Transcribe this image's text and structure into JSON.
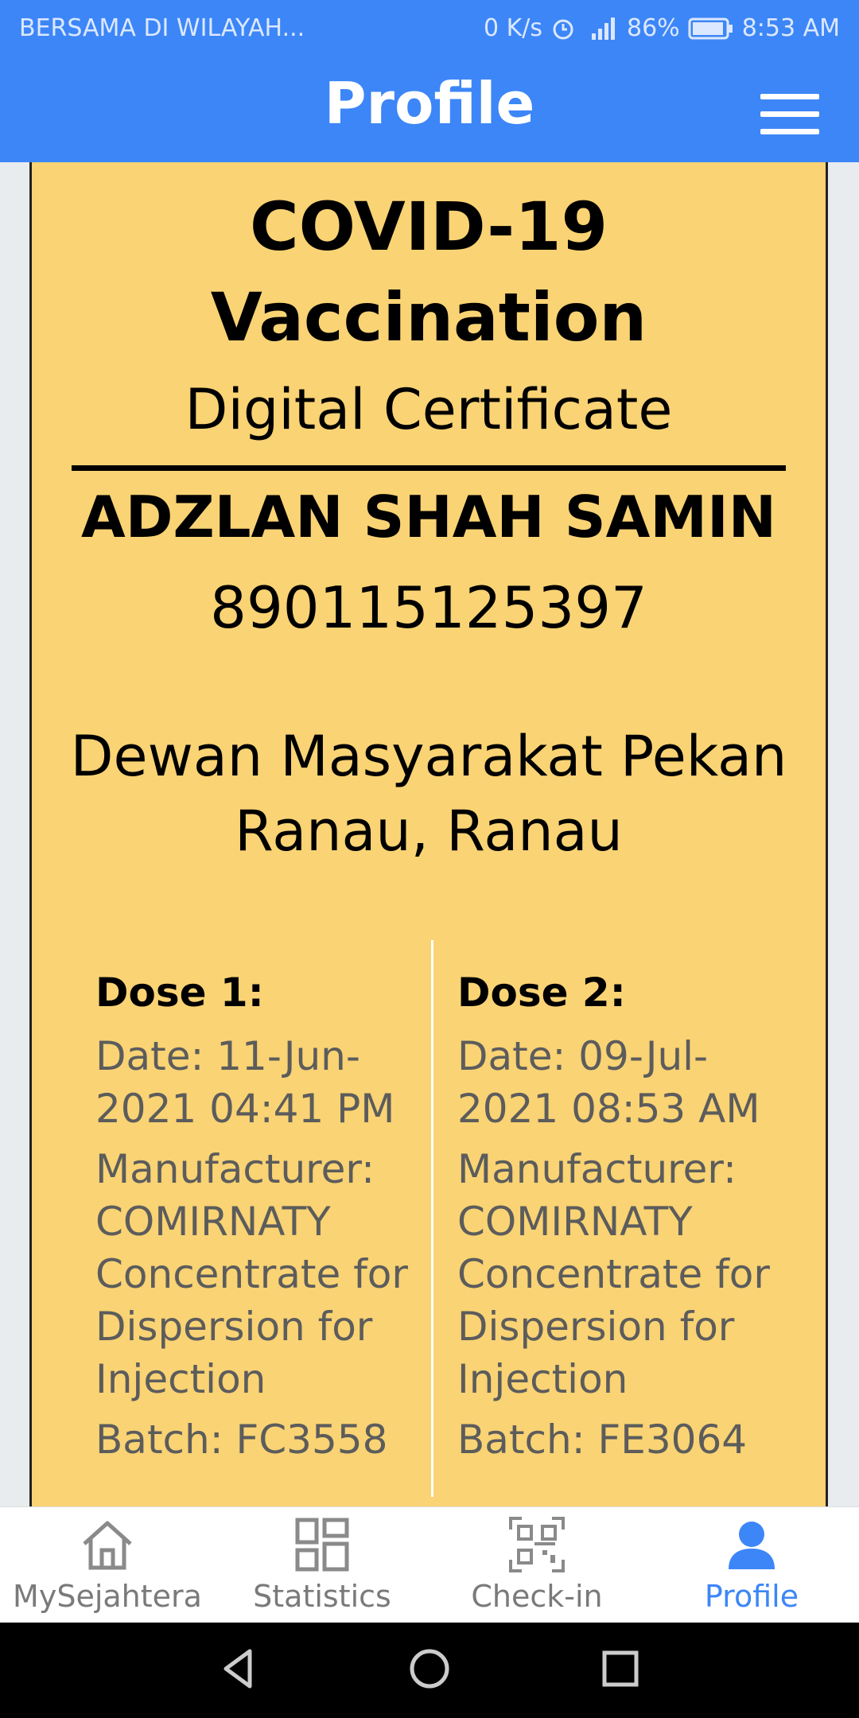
{
  "status_bar": {
    "carrier": "BERSAMA DI WILAYAH...",
    "speed": "0 K/s",
    "battery": "86%",
    "time": "8:53 AM"
  },
  "app_bar": {
    "title": "Profile",
    "menu_icon": "hamburger-menu-icon"
  },
  "certificate": {
    "title_line1": "COVID-19",
    "title_line2": "Vaccination",
    "subtitle": "Digital Certificate",
    "name": "ADZLAN SHAH SAMIN",
    "id_number": "890115125397",
    "location_line1": "Dewan Masyarakat Pekan",
    "location_line2": "Ranau, Ranau",
    "dose1": {
      "heading": "Dose 1:",
      "date_line1": "Date: 11-Jun-",
      "date_line2": "2021 04:41 PM",
      "manufacturer_label": "Manufacturer:",
      "manufacturer_line1": "COMIRNATY",
      "manufacturer_line2": "Concentrate for",
      "manufacturer_line3": "Dispersion for",
      "manufacturer_line4": "Injection",
      "batch": "Batch: FC3558"
    },
    "dose2": {
      "heading": "Dose 2:",
      "date_line1": "Date: 09-Jul-",
      "date_line2": "2021 08:53 AM",
      "manufacturer_label": "Manufacturer:",
      "manufacturer_line1": "COMIRNATY",
      "manufacturer_line2": "Concentrate for",
      "manufacturer_line3": "Dispersion for",
      "manufacturer_line4": "Injection",
      "batch": "Batch: FE3064"
    },
    "background_color": "#f9d374"
  },
  "tabs": [
    {
      "label": "MySejahtera",
      "icon": "home-icon"
    },
    {
      "label": "Statistics",
      "icon": "grid-icon"
    },
    {
      "label": "Check-in",
      "icon": "qr-scan-icon"
    },
    {
      "label": "Profile",
      "icon": "person-icon"
    }
  ],
  "colors": {
    "accent": "#3d86f7",
    "inactive_tab": "#7a7a7a"
  }
}
